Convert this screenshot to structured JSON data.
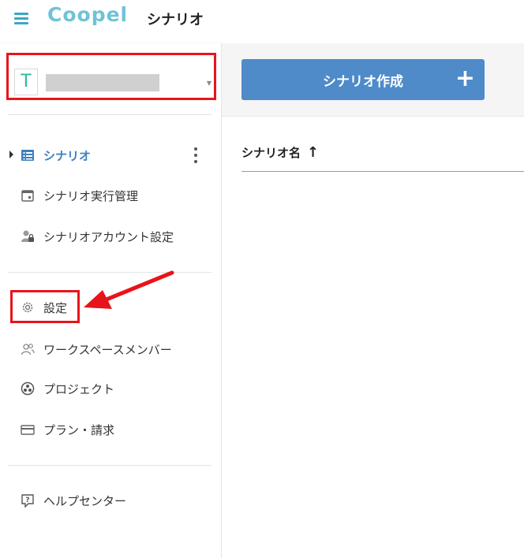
{
  "app": {
    "logo": "Coopel",
    "page_title": "シナリオ"
  },
  "workspace": {
    "initial": "T"
  },
  "nav": {
    "scenario": "シナリオ",
    "scenario_exec": "シナリオ実行管理",
    "scenario_account": "シナリオアカウント設定",
    "settings": "設定",
    "workspace_members": "ワークスペースメンバー",
    "project": "プロジェクト",
    "plan_billing": "プラン・請求",
    "help_center": "ヘルプセンター"
  },
  "main": {
    "create_button": "シナリオ作成",
    "create_plus": "+",
    "column_header": "シナリオ名",
    "sort_arrow": "↑"
  },
  "colors": {
    "accent": "#4f8ac9",
    "active": "#3d7fc1",
    "highlight": "#e8141b",
    "logo": "#6fc3d6"
  }
}
